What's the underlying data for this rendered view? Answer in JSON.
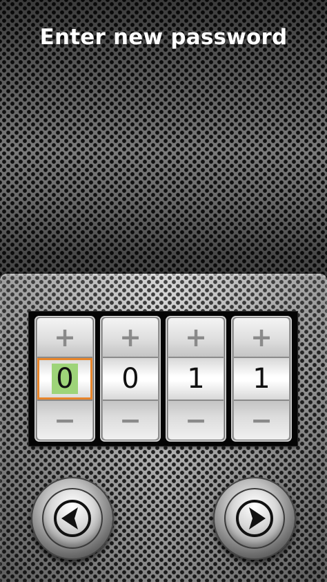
{
  "title": "Enter new password",
  "wheels": [
    {
      "plus": "+",
      "digit": "0",
      "minus": "−",
      "selected": true
    },
    {
      "plus": "+",
      "digit": "0",
      "minus": "−",
      "selected": false
    },
    {
      "plus": "+",
      "digit": "1",
      "minus": "−",
      "selected": false
    },
    {
      "plus": "+",
      "digit": "1",
      "minus": "−",
      "selected": false
    }
  ],
  "nav": {
    "back_icon": "arrow-left-icon",
    "next_icon": "arrow-right-icon"
  },
  "colors": {
    "selected_border": "#e8852a",
    "selected_highlight": "#9ed479",
    "title_text": "#ffffff"
  }
}
